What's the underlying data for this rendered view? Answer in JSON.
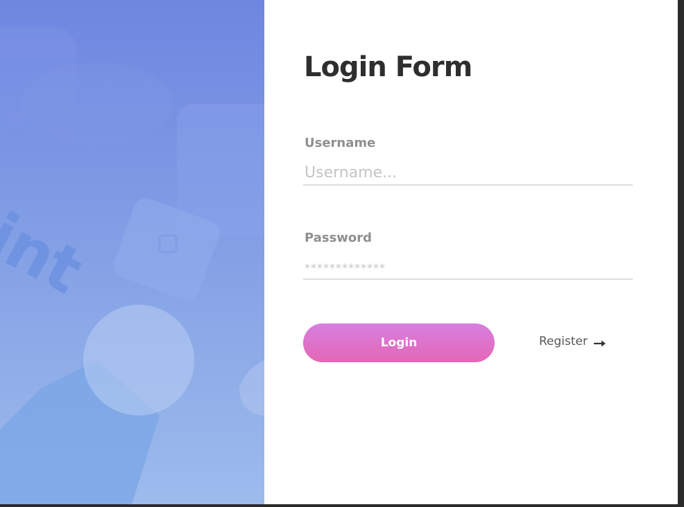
{
  "left_panel": {
    "decorative_word": "int"
  },
  "form": {
    "title": "Login Form",
    "username": {
      "label": "Username",
      "placeholder": "Username..."
    },
    "password": {
      "label": "Password",
      "placeholder": "*************"
    },
    "login_label": "Login",
    "register_label": "Register",
    "register_icon": "arrow-right-icon"
  },
  "colors": {
    "panel_gradient_top": "#6f86e0",
    "panel_gradient_bottom": "#9dbbec",
    "button_gradient_top": "#d77fe0",
    "button_gradient_bottom": "#e467b5",
    "title": "#2e2e2e",
    "label": "#8f8f8f"
  }
}
